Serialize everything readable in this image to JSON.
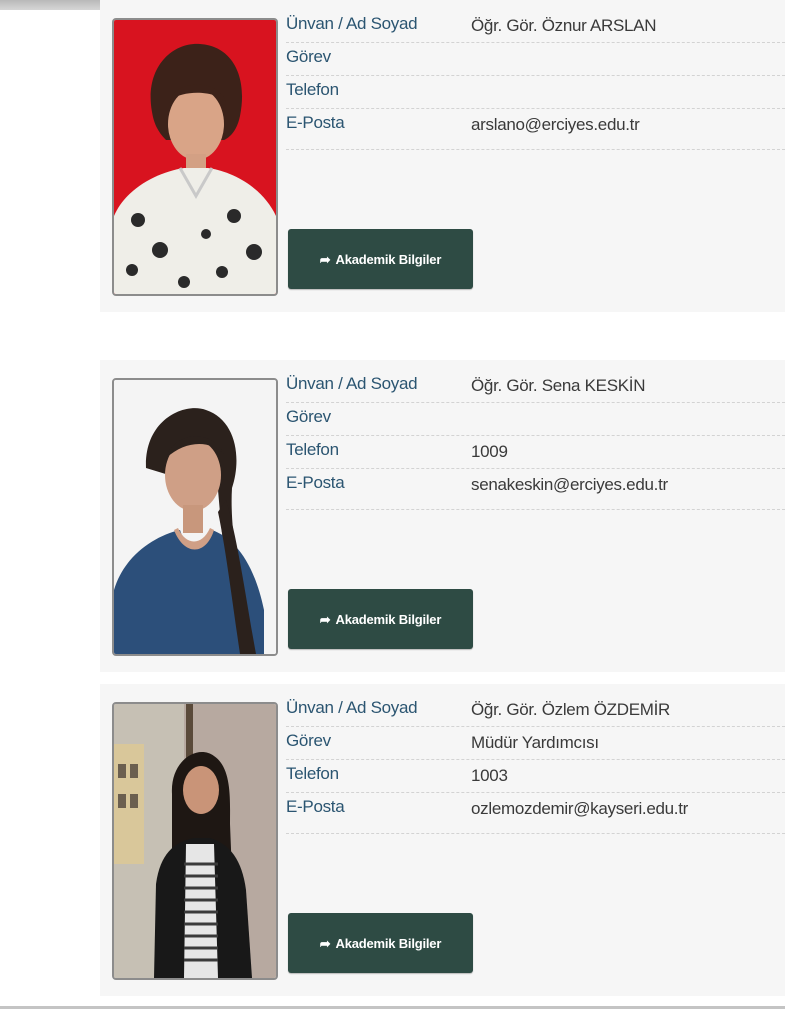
{
  "labels": {
    "title": "Ünvan / Ad Soyad",
    "role": "Görev",
    "phone": "Telefon",
    "email": "E-Posta"
  },
  "button_label": "Akademik Bilgiler",
  "button_icon": "share-arrow-icon",
  "accent_color": "#2e4b44",
  "label_color": "#2b5571",
  "staff": [
    {
      "name": "Öğr. Gör. Sena KESKİN",
      "role": "",
      "phone": "1009",
      "email": "senakeskin@erciyes.edu.tr"
    },
    {
      "name": "Öğr. Gör. Özlem ÖZDEMİR",
      "role": "Müdür Yardımcısı",
      "phone": "1003",
      "email": "ozlemozdemir@kayseri.edu.tr"
    },
    {
      "name": "Öğr. Gör. Öznur ARSLAN",
      "role": "",
      "phone": "",
      "email": "arslano@erciyes.edu.tr"
    }
  ]
}
